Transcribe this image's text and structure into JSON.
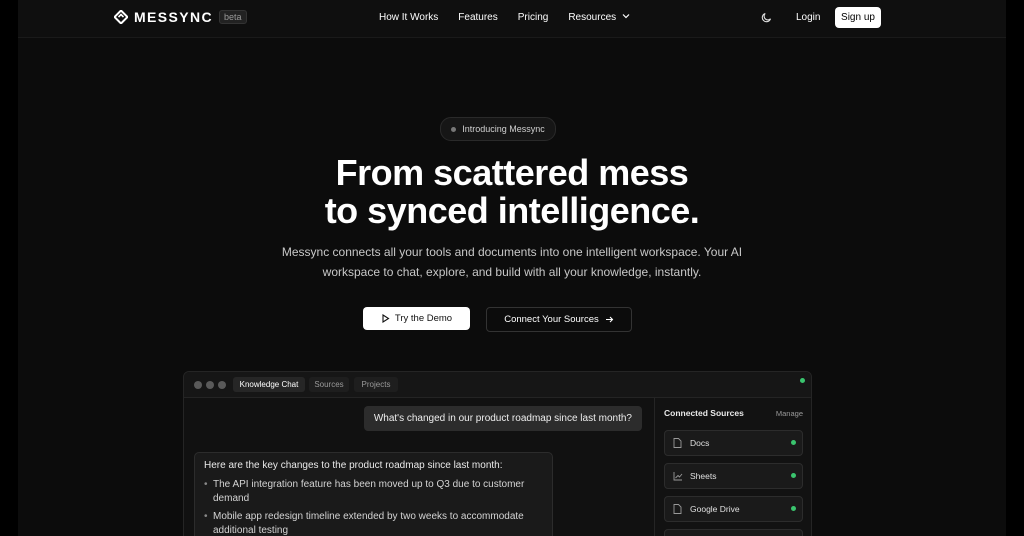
{
  "brand": {
    "name": "MESSYNC",
    "badge": "beta"
  },
  "nav": {
    "links": [
      "How It Works",
      "Features",
      "Pricing",
      "Resources"
    ],
    "login": "Login",
    "signup": "Sign up"
  },
  "hero": {
    "pill": "Introducing Messync",
    "title_line1": "From scattered mess",
    "title_line2": "to synced intelligence.",
    "subtitle_line1": "Messync connects all your tools and documents into one intelligent workspace. Your AI",
    "subtitle_line2": "workspace to chat, explore, and build with all your knowledge, instantly.",
    "demo_button": "Try the Demo",
    "connect_button": "Connect Your Sources"
  },
  "app": {
    "tabs": [
      "Knowledge Chat",
      "Sources",
      "Projects"
    ],
    "user_message": "What's changed in our product roadmap since last month?",
    "ai_intro": "Here are the key changes to the product roadmap since last month:",
    "ai_points": [
      "The API integration feature has been moved up to Q3 due to customer demand",
      "Mobile app redesign timeline extended by two weeks to accommodate additional testing"
    ],
    "sidebar": {
      "title": "Connected Sources",
      "manage": "Manage",
      "sources": [
        {
          "label": "Docs",
          "icon": "doc-icon"
        },
        {
          "label": "Sheets",
          "icon": "chart-icon"
        },
        {
          "label": "Google Drive",
          "icon": "doc-icon"
        }
      ]
    }
  },
  "colors": {
    "background": "#0c0c0c",
    "status_green": "#3ac46e",
    "button_light": "#ffffff"
  }
}
